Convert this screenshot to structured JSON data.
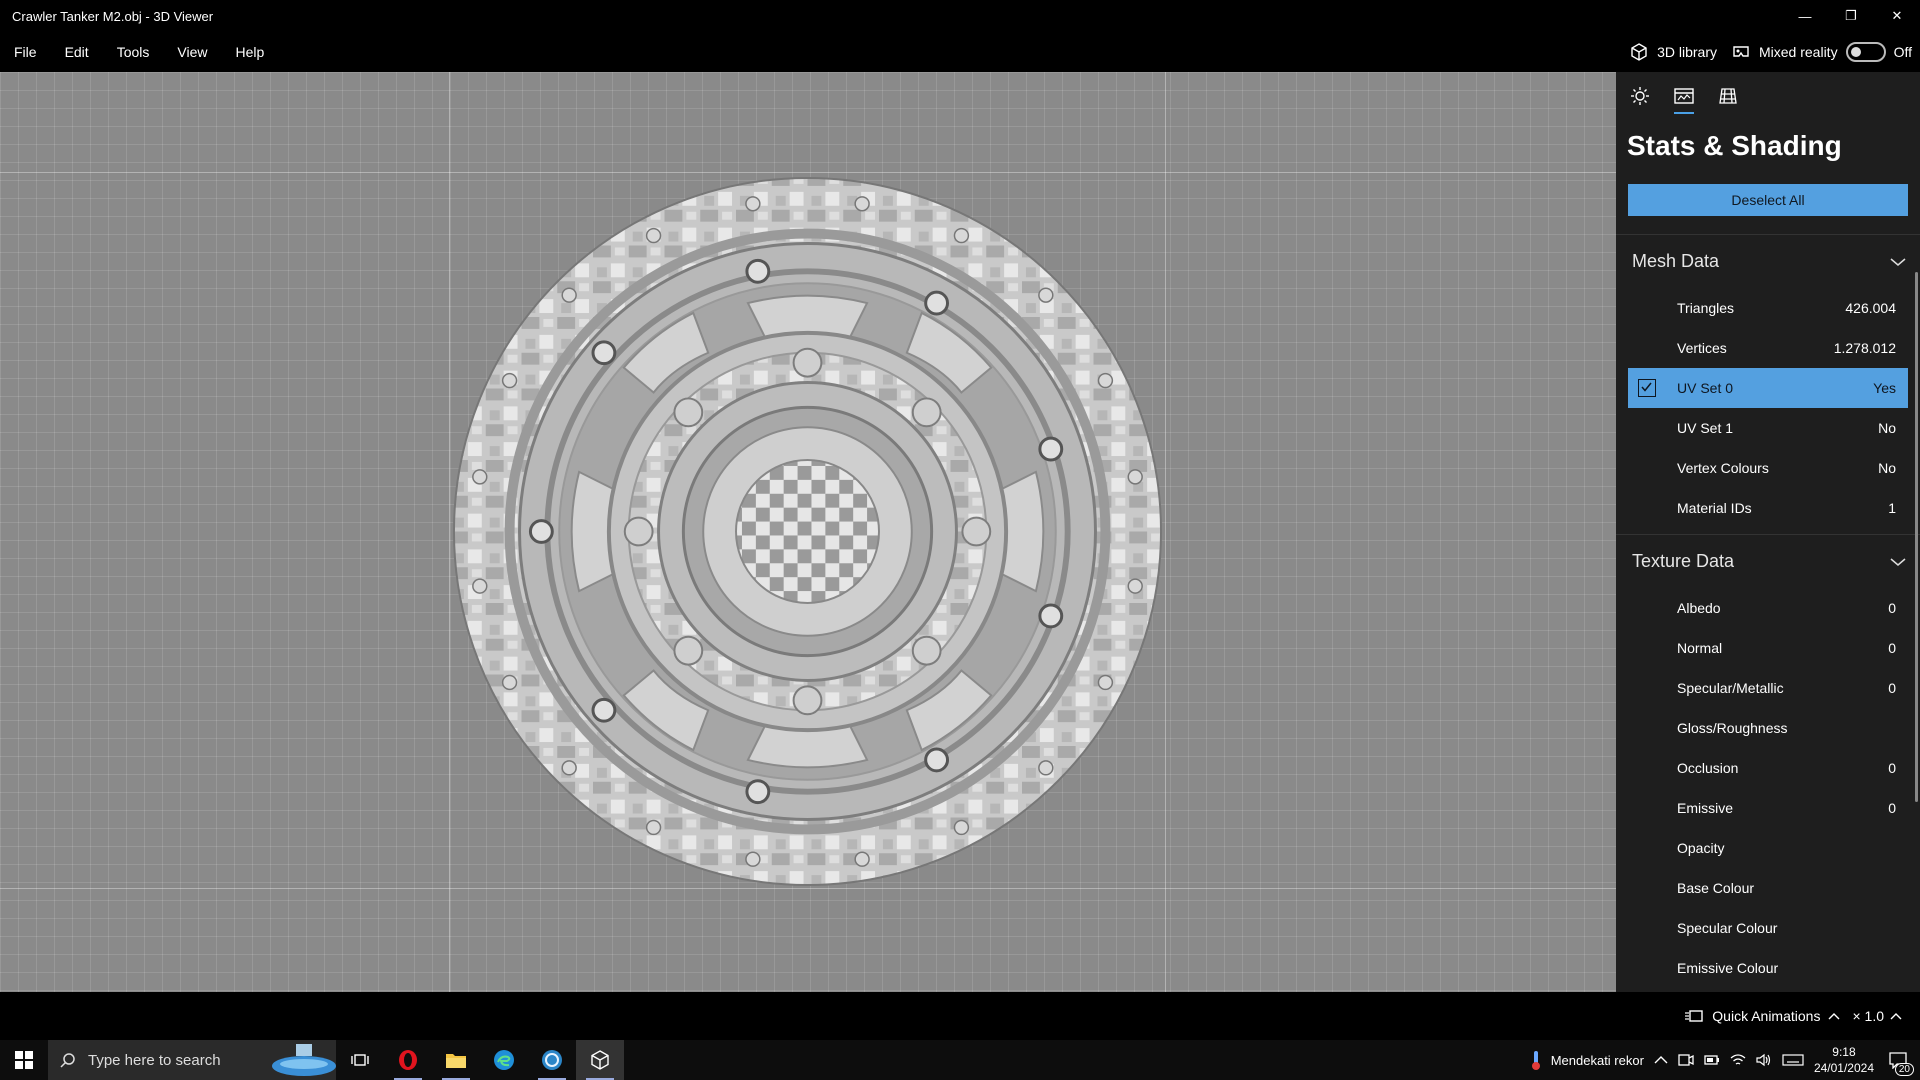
{
  "window": {
    "title": "Crawler Tanker M2.obj - 3D Viewer",
    "minimize": "—",
    "restore": "❐",
    "close": "✕"
  },
  "menu": {
    "items": [
      "File",
      "Edit",
      "Tools",
      "View",
      "Help"
    ],
    "library_label": "3D library",
    "mixed_reality_label": "Mixed reality",
    "mixed_reality_state": "Off"
  },
  "panel": {
    "title": "Stats & Shading",
    "deselect_label": "Deselect All",
    "mesh_section": "Mesh Data",
    "mesh_rows": [
      {
        "label": "Triangles",
        "value": "426.004"
      },
      {
        "label": "Vertices",
        "value": "1.278.012"
      },
      {
        "label": "UV Set 0",
        "value": "Yes"
      },
      {
        "label": "UV Set 1",
        "value": "No"
      },
      {
        "label": "Vertex Colours",
        "value": "No"
      },
      {
        "label": "Material IDs",
        "value": "1"
      }
    ],
    "texture_section": "Texture Data",
    "texture_rows": [
      {
        "label": "Albedo",
        "value": "0"
      },
      {
        "label": "Normal",
        "value": "0"
      },
      {
        "label": "Specular/Metallic",
        "value": "0"
      },
      {
        "label": "Gloss/Roughness",
        "value": ""
      },
      {
        "label": "Occlusion",
        "value": "0"
      },
      {
        "label": "Emissive",
        "value": "0"
      },
      {
        "label": "Opacity",
        "value": ""
      },
      {
        "label": "Base Colour",
        "value": ""
      },
      {
        "label": "Specular Colour",
        "value": ""
      },
      {
        "label": "Emissive Colour",
        "value": ""
      }
    ]
  },
  "bottom": {
    "quick_animations": "Quick Animations",
    "speed": "× 1.0"
  },
  "taskbar": {
    "search_placeholder": "Type here to search",
    "weather_text": "Mendekati rekor",
    "time": "9:18",
    "date": "24/01/2024",
    "notifications": "20"
  },
  "colors": {
    "accent": "#54a0e0",
    "panel_bg": "#1e1e1e",
    "viewport_bg": "#8a8a8a"
  }
}
